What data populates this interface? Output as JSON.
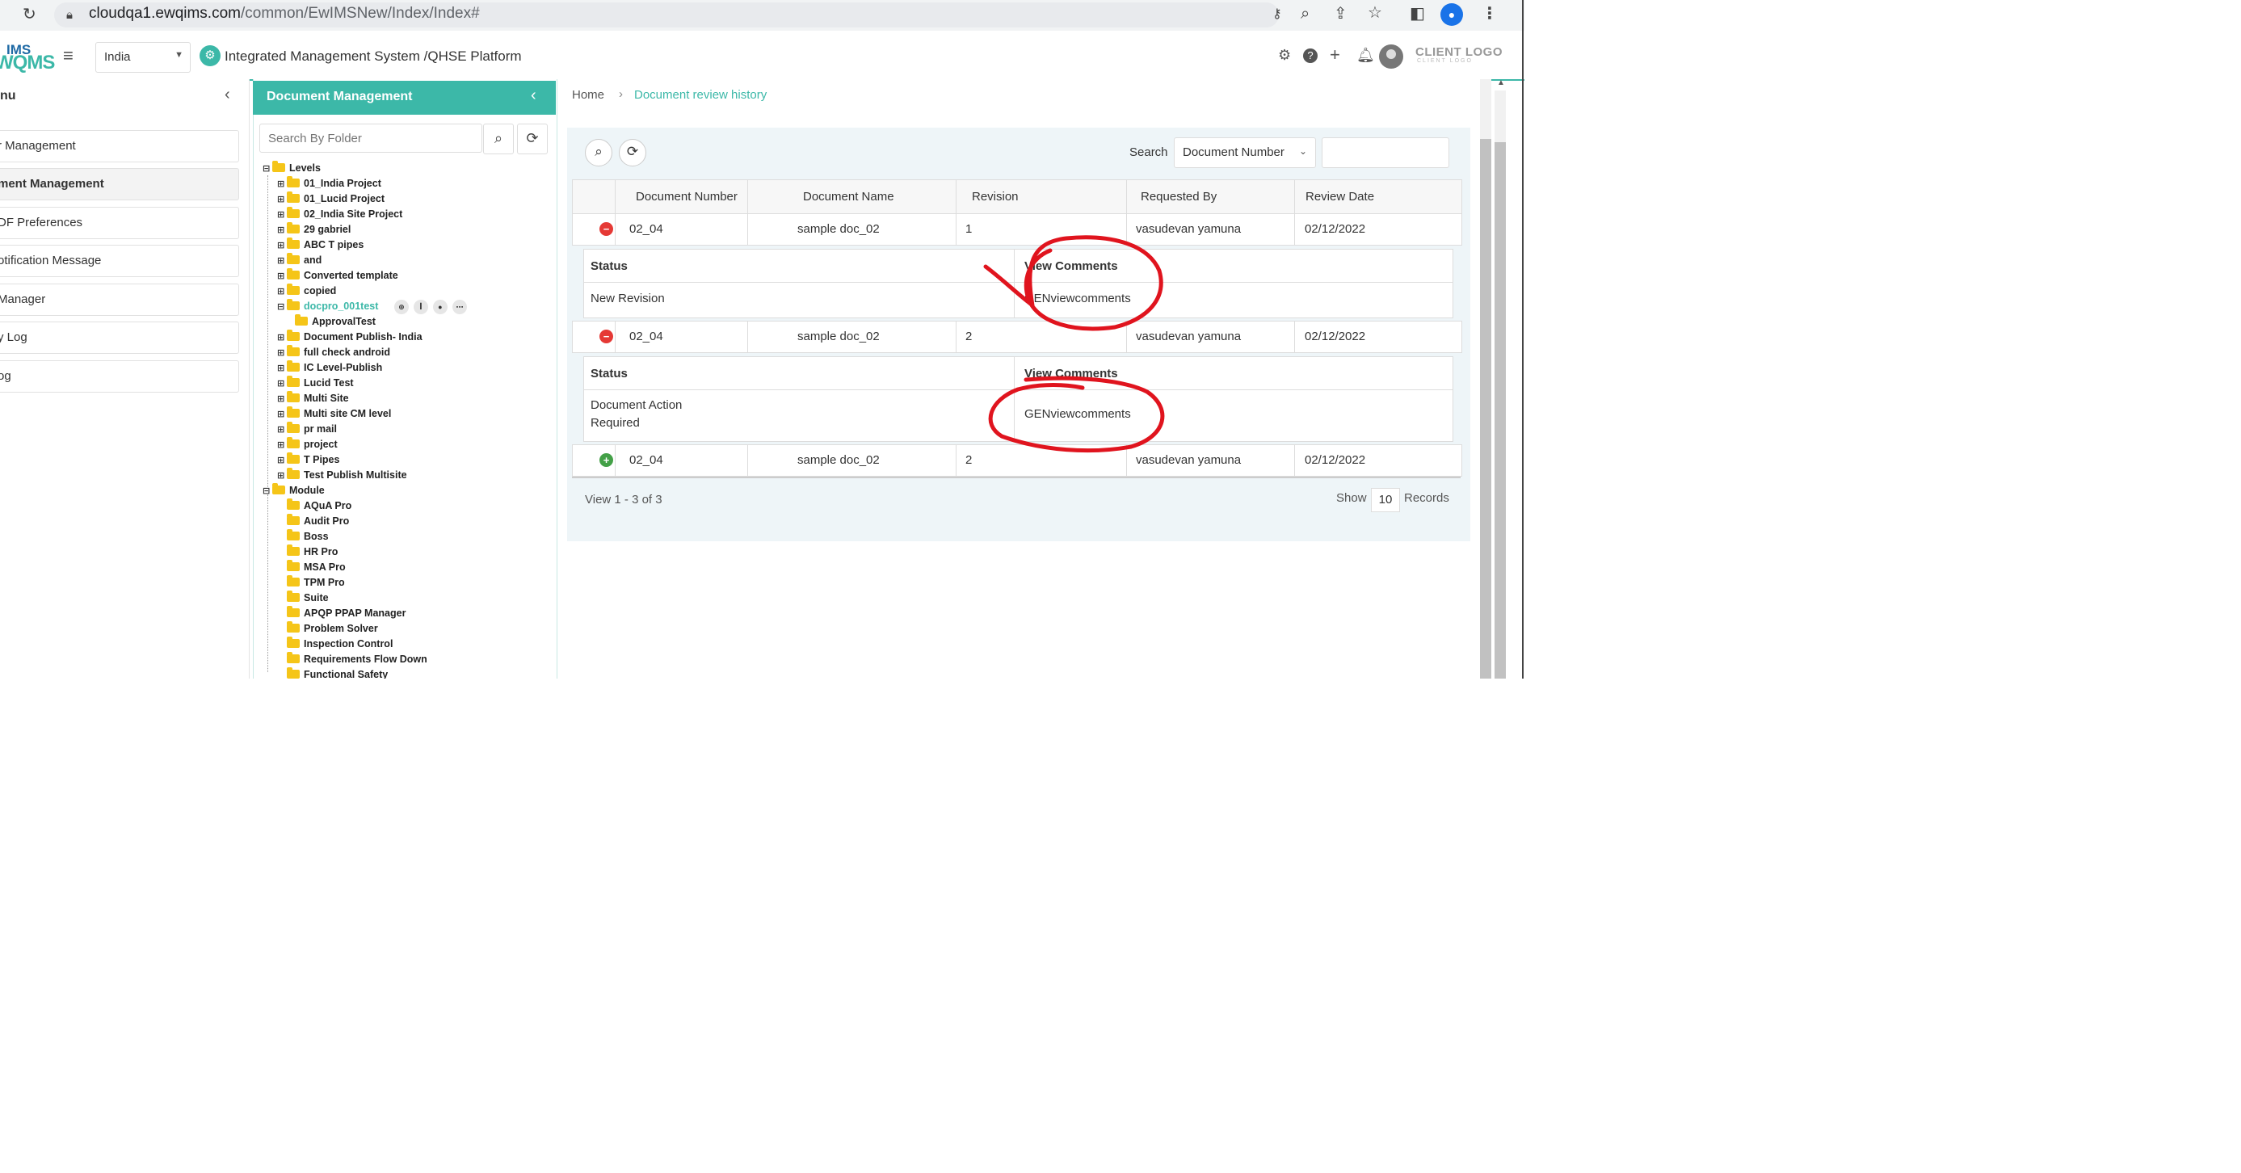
{
  "browser": {
    "url_host": "cloudqa1.ewqims.com",
    "url_path": "/common/EwIMSNew/Index/Index#"
  },
  "header": {
    "logo_top": "IMS",
    "logo_bottom": "WQMS",
    "country": "India",
    "platform_title": "Integrated Management System /QHSE Platform",
    "client_logo": "CLIENT LOGO",
    "client_logo_sub": "CLIENT LOGO"
  },
  "left_menu": {
    "title": "nu",
    "items": [
      {
        "label": "r Management"
      },
      {
        "label": "ment Management"
      },
      {
        "label": "DF Preferences"
      },
      {
        "label": "otification Message"
      },
      {
        "label": "Manager"
      },
      {
        "label": "y Log"
      },
      {
        "label": "og"
      }
    ]
  },
  "doc_panel": {
    "title": "Document Management",
    "search_placeholder": "Search By Folder",
    "tree": [
      {
        "label": "Levels"
      },
      {
        "label": "01_India Project"
      },
      {
        "label": "01_Lucid Project"
      },
      {
        "label": "02_India Site Project"
      },
      {
        "label": "29 gabriel"
      },
      {
        "label": "ABC T pipes"
      },
      {
        "label": "and"
      },
      {
        "label": "Converted template"
      },
      {
        "label": "copied"
      },
      {
        "label": "docpro_001test"
      },
      {
        "label": "ApprovalTest"
      },
      {
        "label": "Document Publish- India"
      },
      {
        "label": "full check android"
      },
      {
        "label": "IC Level-Publish"
      },
      {
        "label": "Lucid Test"
      },
      {
        "label": "Multi Site"
      },
      {
        "label": "Multi site CM level"
      },
      {
        "label": "pr mail"
      },
      {
        "label": "project"
      },
      {
        "label": "T Pipes"
      },
      {
        "label": "Test Publish Multisite"
      },
      {
        "label": "Module"
      },
      {
        "label": "AQuA Pro"
      },
      {
        "label": "Audit Pro"
      },
      {
        "label": "Boss"
      },
      {
        "label": "HR Pro"
      },
      {
        "label": "MSA Pro"
      },
      {
        "label": "TPM Pro"
      },
      {
        "label": "Suite"
      },
      {
        "label": "APQP PPAP Manager"
      },
      {
        "label": "Problem Solver"
      },
      {
        "label": "Inspection Control"
      },
      {
        "label": "Requirements Flow Down"
      },
      {
        "label": "Functional Safety"
      }
    ]
  },
  "breadcrumb": {
    "home": "Home",
    "current": "Document review history"
  },
  "toolbar": {
    "search_label": "Search",
    "search_field": "Document Number",
    "search_value": ""
  },
  "grid": {
    "columns": [
      "Document Number",
      "Document Name",
      "Revision",
      "Requested By",
      "Review Date"
    ],
    "rows": [
      {
        "status": "red",
        "doc_number": "02_04",
        "doc_name": "sample doc_02",
        "revision": "1",
        "requested_by": "vasudevan yamuna",
        "review_date": "02/12/2022",
        "detail": {
          "status_header": "Status",
          "comments_header": "View Comments",
          "status": "New Revision",
          "comments": "GENviewcomments"
        }
      },
      {
        "status": "red",
        "doc_number": "02_04",
        "doc_name": "sample doc_02",
        "revision": "2",
        "requested_by": "vasudevan yamuna",
        "review_date": "02/12/2022",
        "detail": {
          "status_header": "Status",
          "comments_header": "View Comments",
          "status_line1": "Document Action",
          "status_line2": "Required",
          "comments": "GENviewcomments"
        }
      },
      {
        "status": "green",
        "doc_number": "02_04",
        "doc_name": "sample doc_02",
        "revision": "2",
        "requested_by": "vasudevan yamuna",
        "review_date": "02/12/2022"
      }
    ]
  },
  "pager": {
    "view_text": "View 1 - 3 of 3",
    "show_label": "Show",
    "page_size": "10",
    "records_label": "Records"
  },
  "colors": {
    "accent": "#3cb8a8",
    "link": "#2a7fc1",
    "annotation": "#e0141e",
    "status_red": "#e53935",
    "status_green": "#43a047"
  }
}
